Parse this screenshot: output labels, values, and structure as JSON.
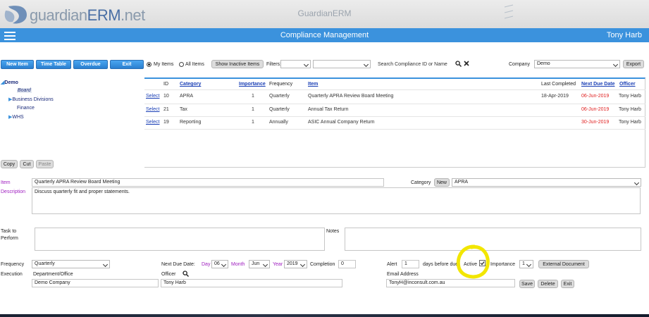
{
  "brand": {
    "logo_part1": "guardian",
    "logo_part2": "ERM",
    "logo_part3": ".net",
    "app_title": "GuardianERM"
  },
  "header": {
    "page_title": "Compliance Management",
    "user_name": "Tony Harb"
  },
  "toolbar": {
    "new_item": "New Item",
    "time_table": "Time Table",
    "overdue": "Overdue",
    "exit": "Exit",
    "my_items": "My Items",
    "all_items": "All Items",
    "show_inactive": "Show Inactive Items",
    "filters_label": "Filters:",
    "filter1_value": "",
    "filter2_value": "",
    "search_placeholder": "Search Compliance ID or Name",
    "company_label": "Company",
    "company_value": "Demo",
    "export": "Export"
  },
  "tree": {
    "root": "Demo",
    "board": "Board",
    "business_divisions": "Business Divisions",
    "finance": "Finance",
    "whs": "WHS"
  },
  "table": {
    "headers": {
      "id": "ID",
      "category": "Category",
      "importance": "Importance",
      "frequency": "Frequency",
      "item": "Item",
      "last_completed": "Last Completed",
      "next_due": "Next Due Date",
      "officer": "Officer"
    },
    "rows": [
      {
        "select": "Select",
        "id": "10",
        "category": "APRA",
        "importance": "1",
        "frequency": "Quarterly",
        "item": "Quarterly APRA Review Board Meeting",
        "last_completed": "18-Apr-2019",
        "next_due": "06-Jun-2019",
        "officer": "Tony Harb"
      },
      {
        "select": "Select",
        "id": "21",
        "category": "Tax",
        "importance": "1",
        "frequency": "Quarterly",
        "item": "Annual Tax Return",
        "last_completed": "",
        "next_due": "06-Jun-2019",
        "officer": "Tony Harb"
      },
      {
        "select": "Select",
        "id": "19",
        "category": "Reporting",
        "importance": "1",
        "frequency": "Annually",
        "item": "ASIC Annual Company Return",
        "last_completed": "",
        "next_due": "30-Jun-2019",
        "officer": "Tony Harb"
      }
    ]
  },
  "clipboard": {
    "copy": "Copy",
    "cut": "Cut",
    "paste": "Paste"
  },
  "form": {
    "item_label": "Item",
    "item_value": "Quarterly APRA Review Board Meeting",
    "category_label": "Category",
    "new_label": "New",
    "category_value": "APRA",
    "description_label": "Description",
    "description_value": "Discuss quarterly fit and proper statements.",
    "task_label_1": "Task to",
    "task_label_2": "Perform",
    "notes_label": "Notes",
    "frequency_label": "Frequency",
    "frequency_value": "Quarterly",
    "next_due_label": "Next Due Date:",
    "day_label": "Day",
    "day_value": "06",
    "month_label": "Month",
    "month_value": "Jun",
    "year_label": "Year",
    "year_value": "2019",
    "completion_label": "Completion",
    "completion_value": "0",
    "alert_label": "Alert",
    "alert_value": "1",
    "days_before_due": "days before due",
    "active_label": "Active",
    "active_checked": true,
    "importance_label": "Importance",
    "importance_value": "1",
    "external_doc": "External Document",
    "execution_label": "Execution",
    "department_label": "Department/Office",
    "department_value": "Demo Company",
    "officer_label": "Officer",
    "officer_value": "Tony Harb",
    "email_label": "Email Address",
    "email_value": "TonyH@inconsult.com.au",
    "save": "Save",
    "delete": "Delete",
    "exit": "Exit"
  },
  "colors": {
    "header_blue": "#3b92dd",
    "due_red": "#e02020",
    "link_blue": "#1a3fb5",
    "label_purple": "#a020c0",
    "highlight_yellow": "#f2e600"
  }
}
